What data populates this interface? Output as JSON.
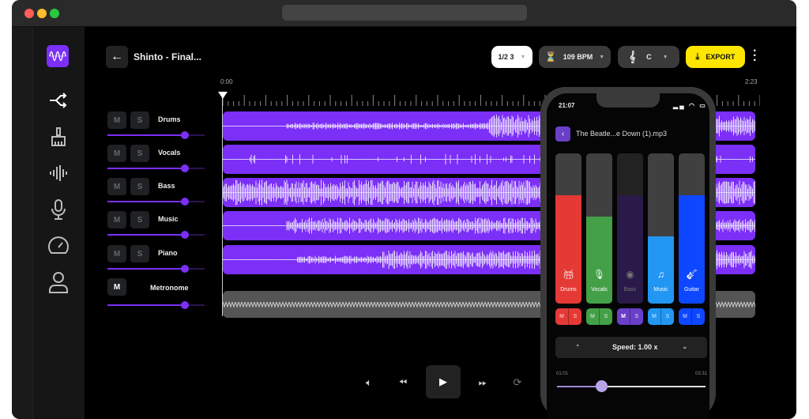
{
  "project": {
    "title": "Shinto - Final...",
    "start_time": "0:00",
    "end_time": "2:23"
  },
  "toolbar": {
    "time_signature": "1/2 3",
    "tempo": "109 BPM",
    "key": "C",
    "export_label": "EXPORT"
  },
  "tracks": [
    {
      "name": "Drums",
      "mute": "M",
      "solo": "S",
      "volume": 0.8
    },
    {
      "name": "Vocals",
      "mute": "M",
      "solo": "S",
      "volume": 0.8
    },
    {
      "name": "Bass",
      "mute": "M",
      "solo": "S",
      "volume": 0.8
    },
    {
      "name": "Music",
      "mute": "M",
      "solo": "S",
      "volume": 0.8
    },
    {
      "name": "Piano",
      "mute": "M",
      "solo": "S",
      "volume": 0.8
    },
    {
      "name": "Metronome",
      "mute": "M",
      "volume": 0.8
    }
  ],
  "sidebar": [
    "shuffle-icon",
    "broom-icon",
    "waveform-icon",
    "microphone-icon",
    "speedometer-icon",
    "user-icon"
  ],
  "phone": {
    "clock": "21:07",
    "file_name": "The Beatle...e Down (1).mp3",
    "stems": [
      {
        "name": "Drums",
        "color": "#e53935",
        "level": 0.72,
        "mute": "M",
        "solo": "S"
      },
      {
        "name": "Vocals",
        "color": "#43a047",
        "level": 0.58,
        "mute": "M",
        "solo": "S"
      },
      {
        "name": "Bass",
        "color": "#2a1a4a",
        "level": 0.72,
        "mute": "M",
        "solo": "S"
      },
      {
        "name": "Music",
        "color": "#2196f3",
        "level": 0.45,
        "mute": "M",
        "solo": "S"
      },
      {
        "name": "Guitar",
        "color": "#0d47ff",
        "level": 0.72,
        "mute": "M",
        "solo": "S"
      }
    ],
    "speed": "Speed: 1.00 x",
    "current_time": "01:01",
    "total_time": "03:31",
    "progress": 0.3
  },
  "colors": {
    "accent": "#7b2ff7",
    "export": "#ffe600"
  }
}
